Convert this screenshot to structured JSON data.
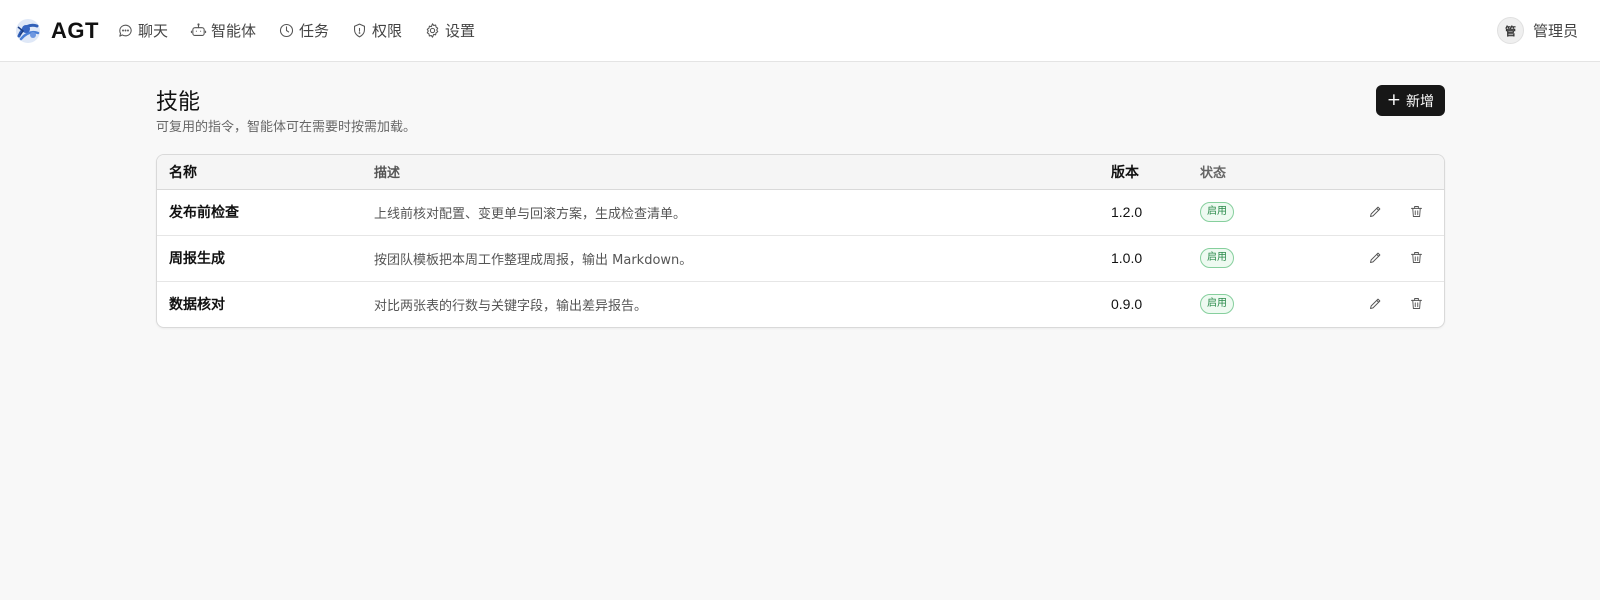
{
  "app": {
    "brand": "AGT"
  },
  "nav": [
    {
      "label": "聊天",
      "icon": "chat-bubble-icon"
    },
    {
      "label": "智能体",
      "icon": "robot-icon"
    },
    {
      "label": "任务",
      "icon": "clock-icon"
    },
    {
      "label": "权限",
      "icon": "shield-icon"
    },
    {
      "label": "设置",
      "icon": "gear-icon"
    }
  ],
  "user": {
    "avatar": "管",
    "name": "管理员"
  },
  "page": {
    "title": "技能",
    "subtitle": "可复用的指令，智能体可在需要时按需加载。",
    "add_label": "新增"
  },
  "table": {
    "headers": [
      "名称",
      "描述",
      "版本",
      "状态"
    ],
    "rows": [
      {
        "name": "发布前检查",
        "description": "上线前核对配置、变更单与回滚方案，生成检查清单。",
        "version": "1.2.0",
        "status": "启用"
      },
      {
        "name": "周报生成",
        "description": "按团队模板把本周工作整理成周报，输出 Markdown。",
        "version": "1.0.0",
        "status": "启用"
      },
      {
        "name": "数据核对",
        "description": "对比两张表的行数与关键字段，输出差异报告。",
        "version": "0.9.0",
        "status": "启用"
      }
    ]
  },
  "colors": {
    "accent": "#171717",
    "status_enabled": "#2a8a4a",
    "status_enabled_bg": "#eefaf1"
  }
}
